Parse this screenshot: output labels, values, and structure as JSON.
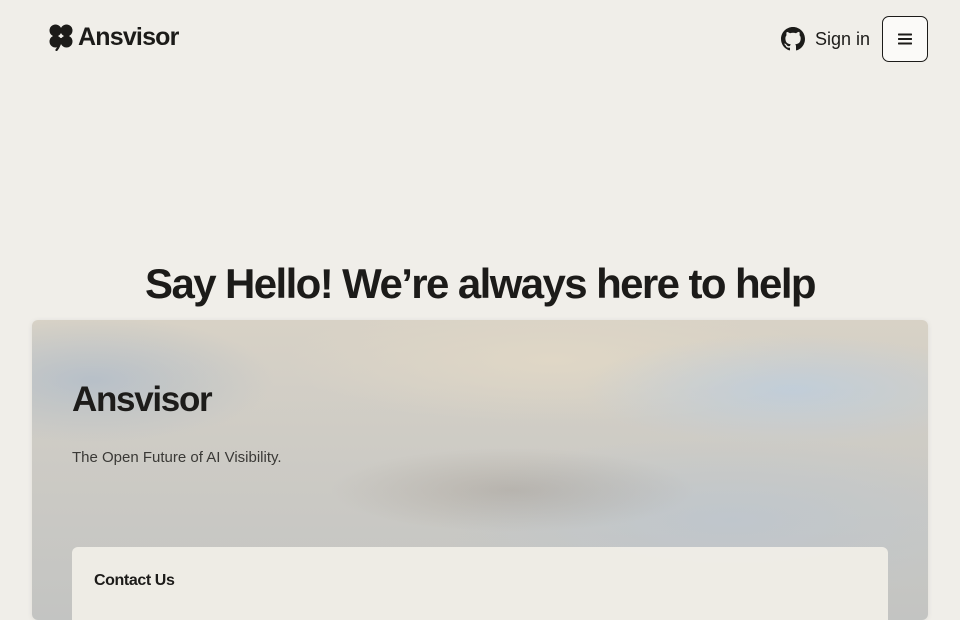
{
  "header": {
    "logo_text": "Ansvisor",
    "logo_icon": "clover-icon",
    "github_icon": "github-icon",
    "signin_label": "Sign in",
    "menu_icon": "hamburger-icon"
  },
  "hero": {
    "title": "Say Hello! We’re always here to help"
  },
  "card": {
    "title": "Ansvisor",
    "tagline": "The Open Future of AI Visibility.",
    "contact_heading": "Contact Us"
  },
  "colors": {
    "background": "#f0eee9",
    "text": "#1c1b19",
    "panel": "#f0ede6"
  }
}
